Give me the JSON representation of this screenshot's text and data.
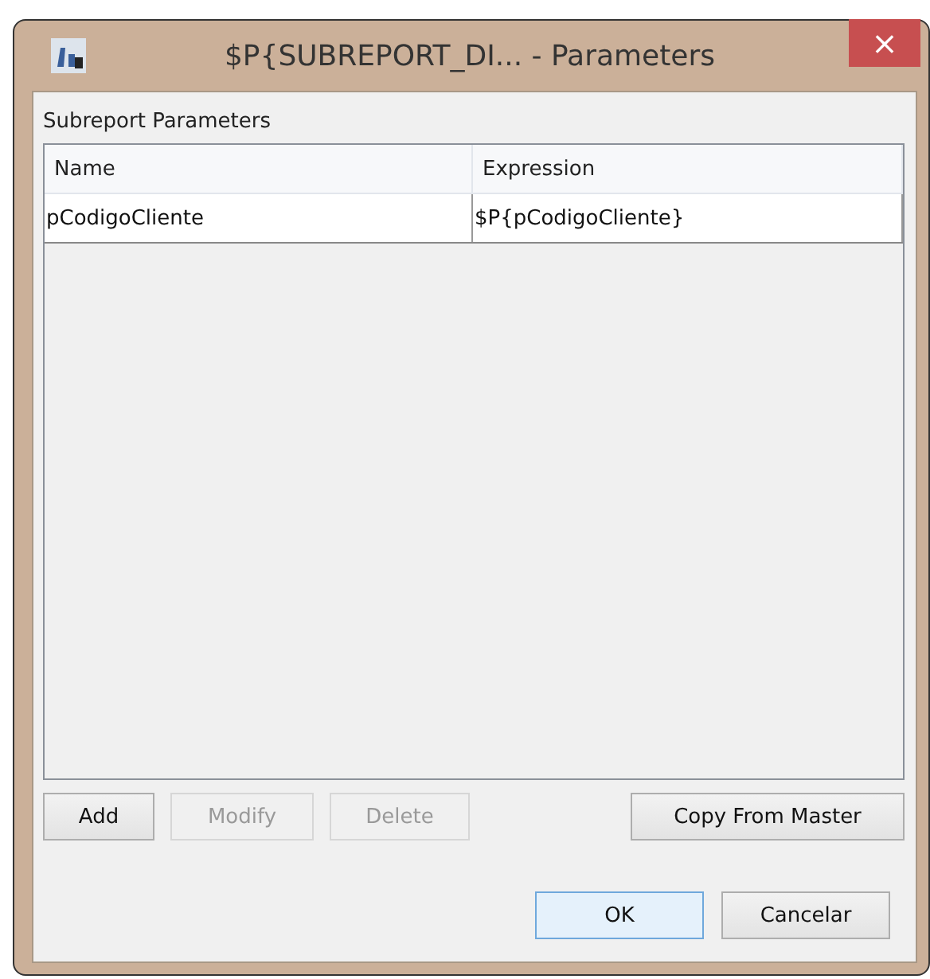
{
  "window": {
    "title": "$P{SUBREPORT_DI... - Parameters",
    "close": "×"
  },
  "section_label": "Subreport Parameters",
  "table": {
    "columns": [
      "Name",
      "Expression"
    ],
    "rows": [
      [
        "pCodigoCliente",
        "$P{pCodigoCliente}"
      ]
    ]
  },
  "table_buttons": [
    {
      "label": "Add",
      "disabled": false
    },
    {
      "label": "Modify",
      "disabled": true
    },
    {
      "label": "Delete",
      "disabled": true
    },
    {
      "label": "Copy From Master",
      "disabled": false
    }
  ],
  "dialog_buttons": [
    {
      "label": "OK",
      "default": true
    },
    {
      "label": "Cancelar",
      "default": false
    }
  ]
}
